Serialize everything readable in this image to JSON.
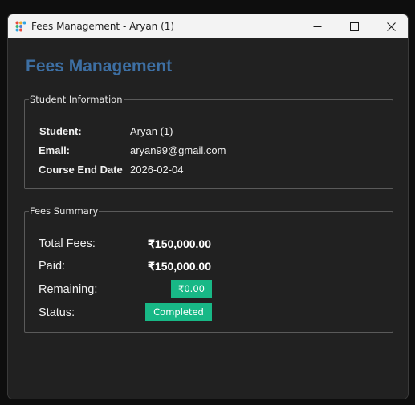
{
  "window": {
    "title": "Fees Management - Aryan (1)",
    "icon": "app-dots-icon",
    "controls": [
      "minimize-icon",
      "maximize-icon",
      "close-icon"
    ]
  },
  "app": {
    "heading": "Fees Management",
    "heading_color": "#3d6fa3"
  },
  "student_info": {
    "legend": "Student Information",
    "rows": [
      {
        "label": "Student:",
        "value": "Aryan (1)"
      },
      {
        "label": "Email:",
        "value": "aryan99@gmail.com"
      },
      {
        "label": "Course End Date",
        "value": "2026-02-04"
      }
    ]
  },
  "fees_summary": {
    "legend": "Fees Summary",
    "total_label": "Total Fees:",
    "total_value": "₹150,000.00",
    "paid_label": "Paid:",
    "paid_value": "₹150,000.00",
    "remaining_label": "Remaining:",
    "remaining_value": "₹0.00",
    "status_label": "Status:",
    "status_value": "Completed",
    "badge_color": "#18b886"
  }
}
